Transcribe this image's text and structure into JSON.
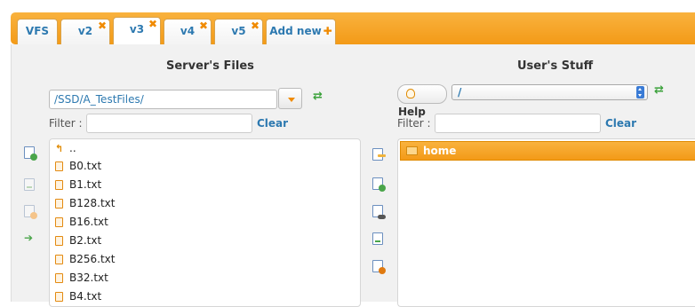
{
  "tabs": [
    {
      "label": "VFS",
      "closable": false,
      "active": false
    },
    {
      "label": "v2",
      "closable": true,
      "active": false
    },
    {
      "label": "v3",
      "closable": true,
      "active": true
    },
    {
      "label": "v4",
      "closable": true,
      "active": false
    },
    {
      "label": "v5",
      "closable": true,
      "active": false
    }
  ],
  "add_tab_label": "Add new",
  "close_glyph": "✖",
  "add_glyph": "✚",
  "server": {
    "title": "Server's Files",
    "path": "/SSD/A_TestFiles/",
    "filter_label": "Filter :",
    "filter_value": "",
    "clear_label": "Clear",
    "parent_label": "..",
    "files": [
      "B0.txt",
      "B1.txt",
      "B128.txt",
      "B16.txt",
      "B2.txt",
      "B256.txt",
      "B32.txt",
      "B4.txt"
    ]
  },
  "user": {
    "title": "User's Stuff",
    "help_label": "Help",
    "path": "/",
    "filter_label": "Filter :",
    "filter_value": "",
    "clear_label": "Clear",
    "items": [
      {
        "label": "home",
        "selected": true
      }
    ]
  },
  "colors": {
    "accent": "#f39a17",
    "link": "#2d79b0"
  }
}
